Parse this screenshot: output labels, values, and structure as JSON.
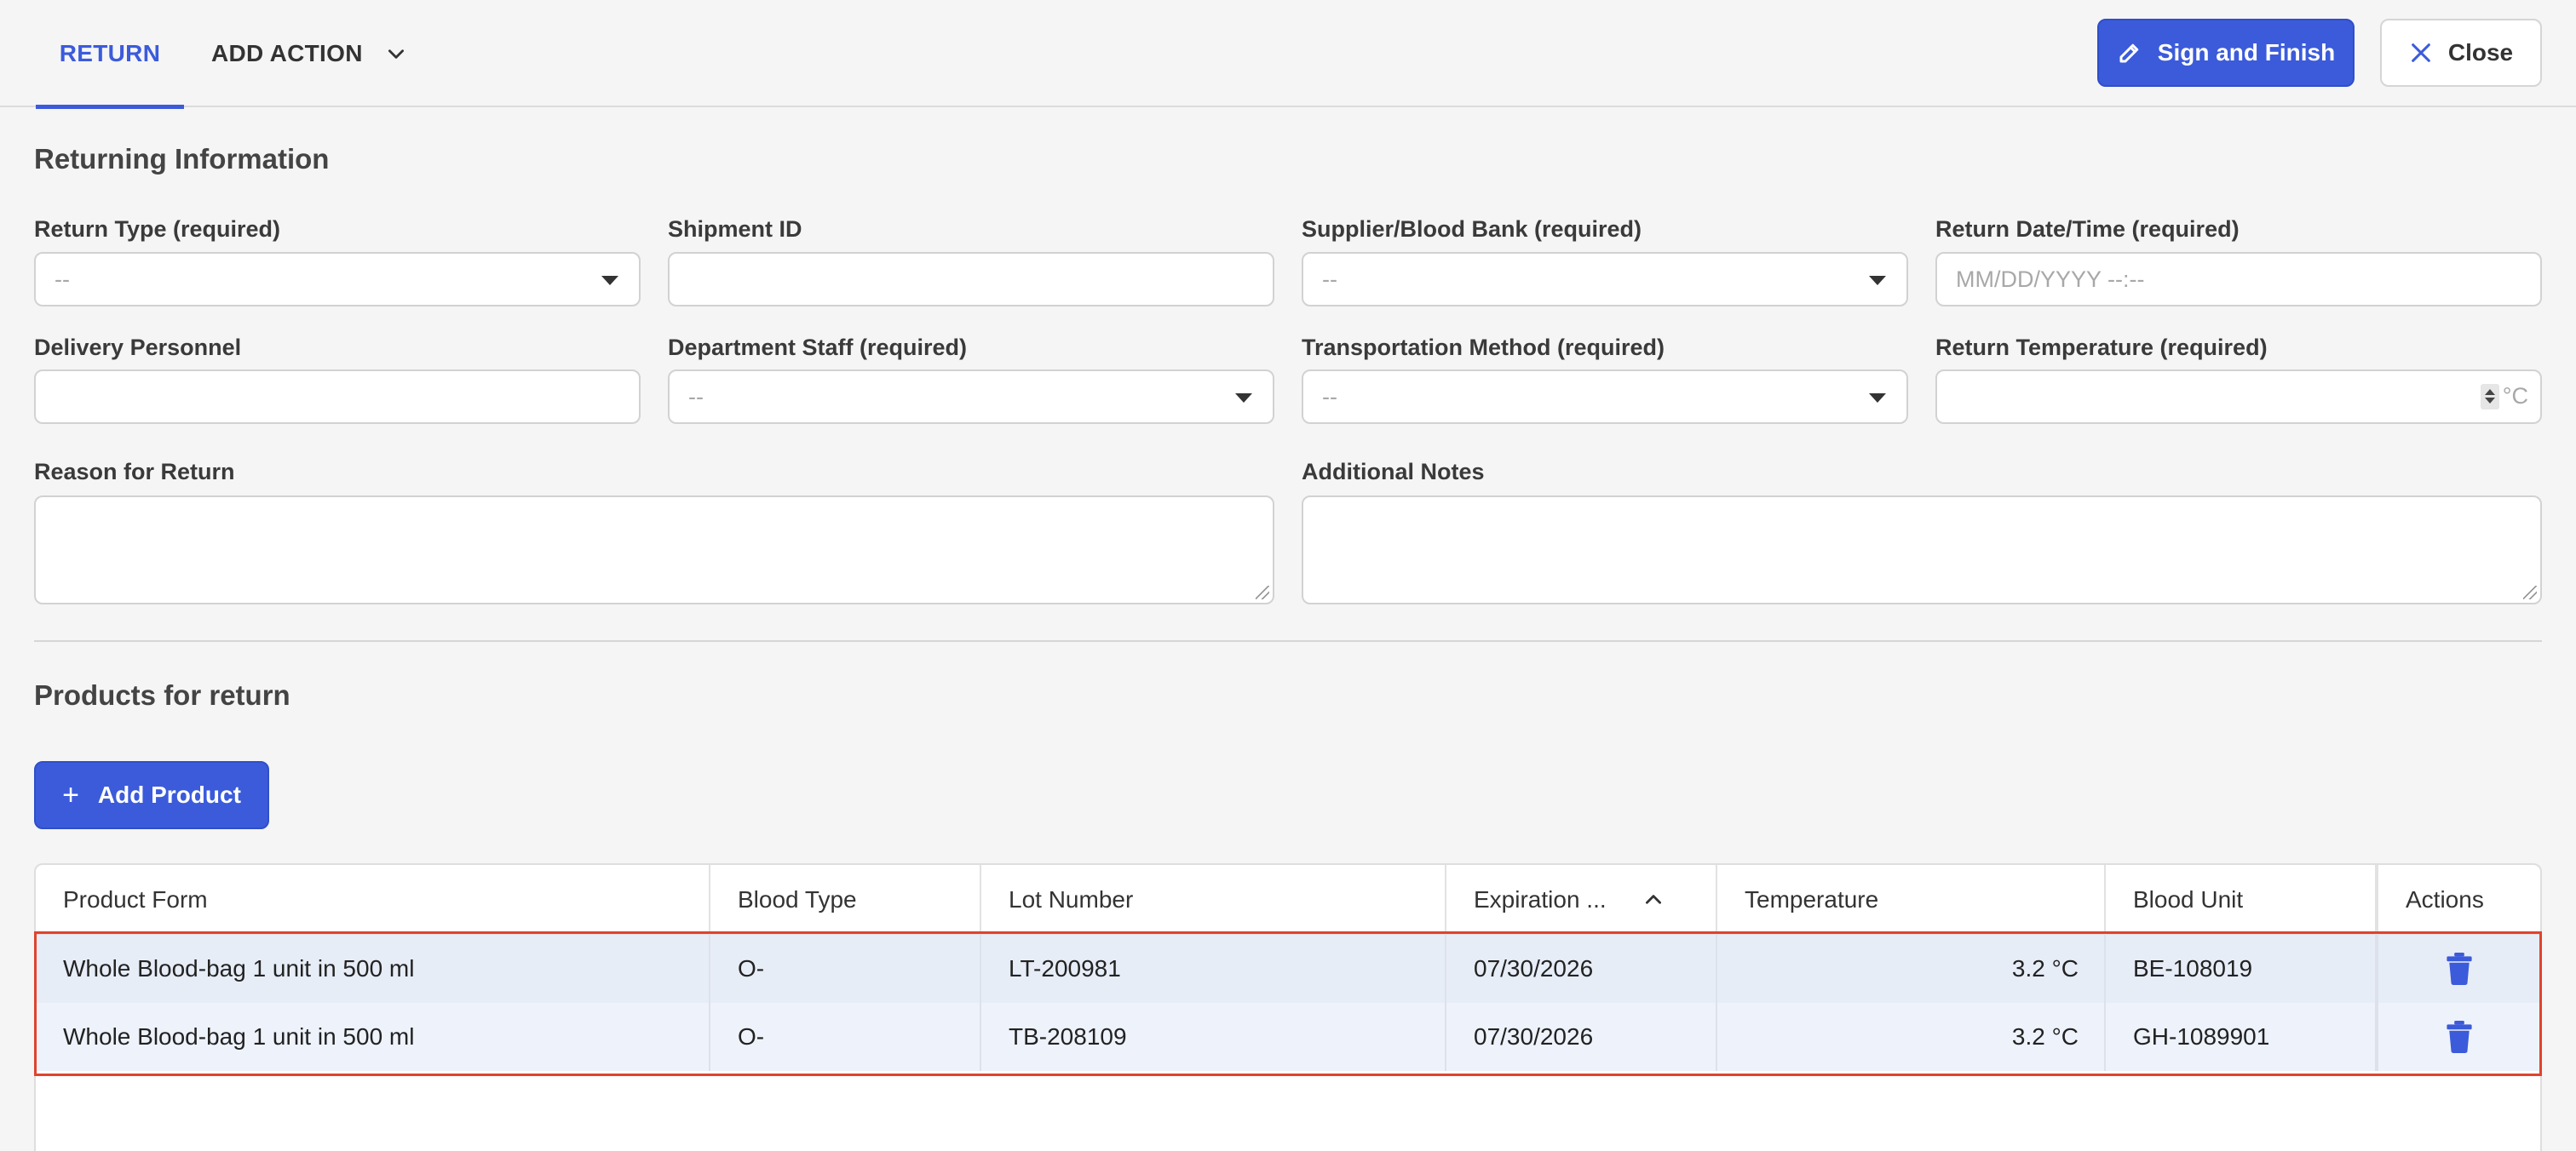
{
  "topbar": {
    "tab_return": "RETURN",
    "tab_add_action": "ADD ACTION",
    "sign_button": "Sign and Finish",
    "close_button": "Close"
  },
  "returning_info": {
    "title": "Returning Information",
    "return_type": {
      "label": "Return Type (required)",
      "value": "--"
    },
    "shipment_id": {
      "label": "Shipment ID",
      "value": ""
    },
    "supplier": {
      "label": "Supplier/Blood Bank (required)",
      "value": "--"
    },
    "return_datetime": {
      "label": "Return Date/Time (required)",
      "placeholder": "MM/DD/YYYY --:--"
    },
    "delivery_personnel": {
      "label": "Delivery Personnel",
      "value": ""
    },
    "department_staff": {
      "label": "Department Staff (required)",
      "value": "--"
    },
    "transportation": {
      "label": "Transportation Method (required)",
      "value": "--"
    },
    "return_temperature": {
      "label": "Return Temperature (required)",
      "unit": "°C"
    },
    "reason": {
      "label": "Reason for Return"
    },
    "notes": {
      "label": "Additional Notes"
    }
  },
  "products": {
    "title": "Products for return",
    "add_button": "Add Product",
    "columns": [
      "Product Form",
      "Blood Type",
      "Lot Number",
      "Expiration ...",
      "Temperature",
      "Blood Unit",
      "Actions"
    ],
    "rows": [
      {
        "product_form": "Whole Blood-bag 1 unit in 500 ml",
        "blood_type": "O-",
        "lot_number": "LT-200981",
        "expiration": "07/30/2026",
        "temperature": "3.2 °C",
        "blood_unit": "BE-108019"
      },
      {
        "product_form": "Whole Blood-bag 1 unit in 500 ml",
        "blood_type": "O-",
        "lot_number": "TB-208109",
        "expiration": "07/30/2026",
        "temperature": "3.2 °C",
        "blood_unit": "GH-1089901"
      }
    ]
  },
  "colors": {
    "accent": "#3b5bdb",
    "selection_outline": "#e0432e"
  },
  "icons": [
    "chevron-down-icon",
    "pencil-icon",
    "close-icon",
    "dropdown-caret-icon",
    "spinner-icon",
    "plus-icon",
    "sort-up-icon",
    "trash-icon"
  ]
}
